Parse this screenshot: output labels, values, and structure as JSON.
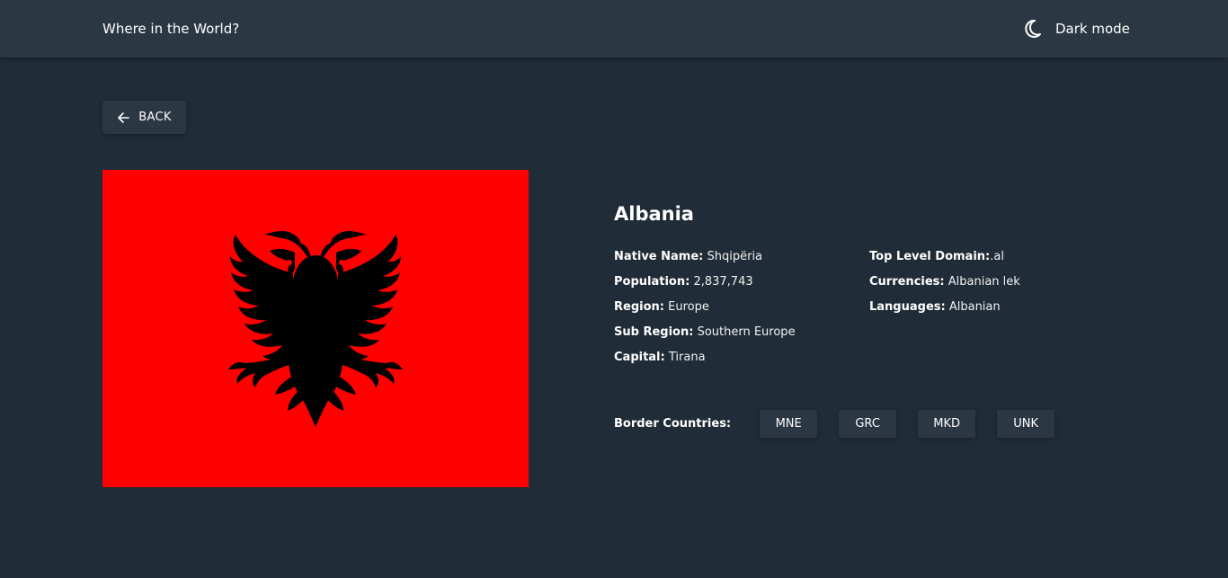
{
  "header": {
    "title": "Where in the World?",
    "theme_toggle_label": "Dark mode",
    "theme_icon": "moon-icon"
  },
  "back_button": {
    "label": "BACK",
    "icon": "arrow-left-icon"
  },
  "country": {
    "name": "Albania",
    "flag_icon": "albania-flag",
    "details_left": [
      {
        "label": "Native Name:",
        "value": "Shqipëria"
      },
      {
        "label": "Population:",
        "value": "2,837,743"
      },
      {
        "label": "Region:",
        "value": "Europe"
      },
      {
        "label": "Sub Region:",
        "value": "Southern Europe"
      },
      {
        "label": "Capital:",
        "value": "Tirana"
      }
    ],
    "details_right": [
      {
        "label": "Top Level Domain:",
        "value": ".al"
      },
      {
        "label": "Currencies:",
        "value": "Albanian lek"
      },
      {
        "label": "Languages:",
        "value": "Albanian"
      }
    ],
    "border_countries_label": "Border Countries:",
    "border_countries": [
      "MNE",
      "GRC",
      "MKD",
      "UNK"
    ]
  },
  "colors": {
    "background": "#202c37",
    "surface": "#2b3743",
    "text": "#ffffff",
    "flag_red": "#ff0000",
    "flag_eagle": "#000000"
  }
}
